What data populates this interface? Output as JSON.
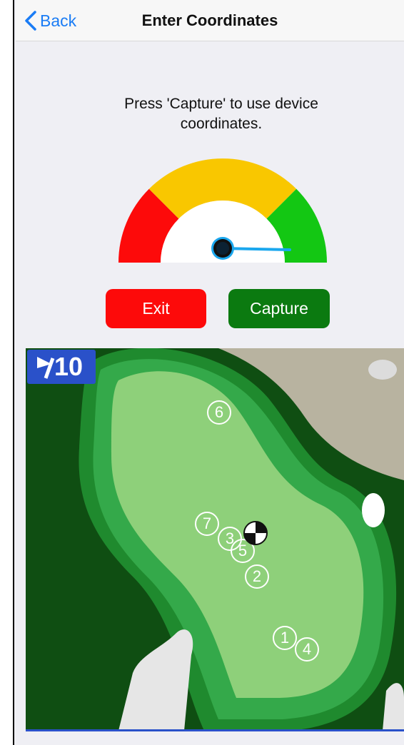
{
  "nav": {
    "back_label": "Back",
    "title": "Enter Coordinates"
  },
  "instructions": "Press 'Capture' to use device coordinates.",
  "gauge": {
    "level_fraction": 0.98,
    "zones": [
      "#fd0a0a",
      "#f9c700",
      "#13c713"
    ]
  },
  "buttons": {
    "exit_label": "Exit",
    "capture_label": "Capture"
  },
  "hole": {
    "number": "10"
  },
  "pins": [
    {
      "label": "6"
    },
    {
      "label": "7"
    },
    {
      "label": "3"
    },
    {
      "label": "5"
    },
    {
      "label": "2"
    },
    {
      "label": "1"
    },
    {
      "label": "4"
    }
  ],
  "colors": {
    "accent": "#1a7cf5",
    "exit": "#fd0a0a",
    "capture": "#0b7a10",
    "badge": "#2a51c9"
  }
}
